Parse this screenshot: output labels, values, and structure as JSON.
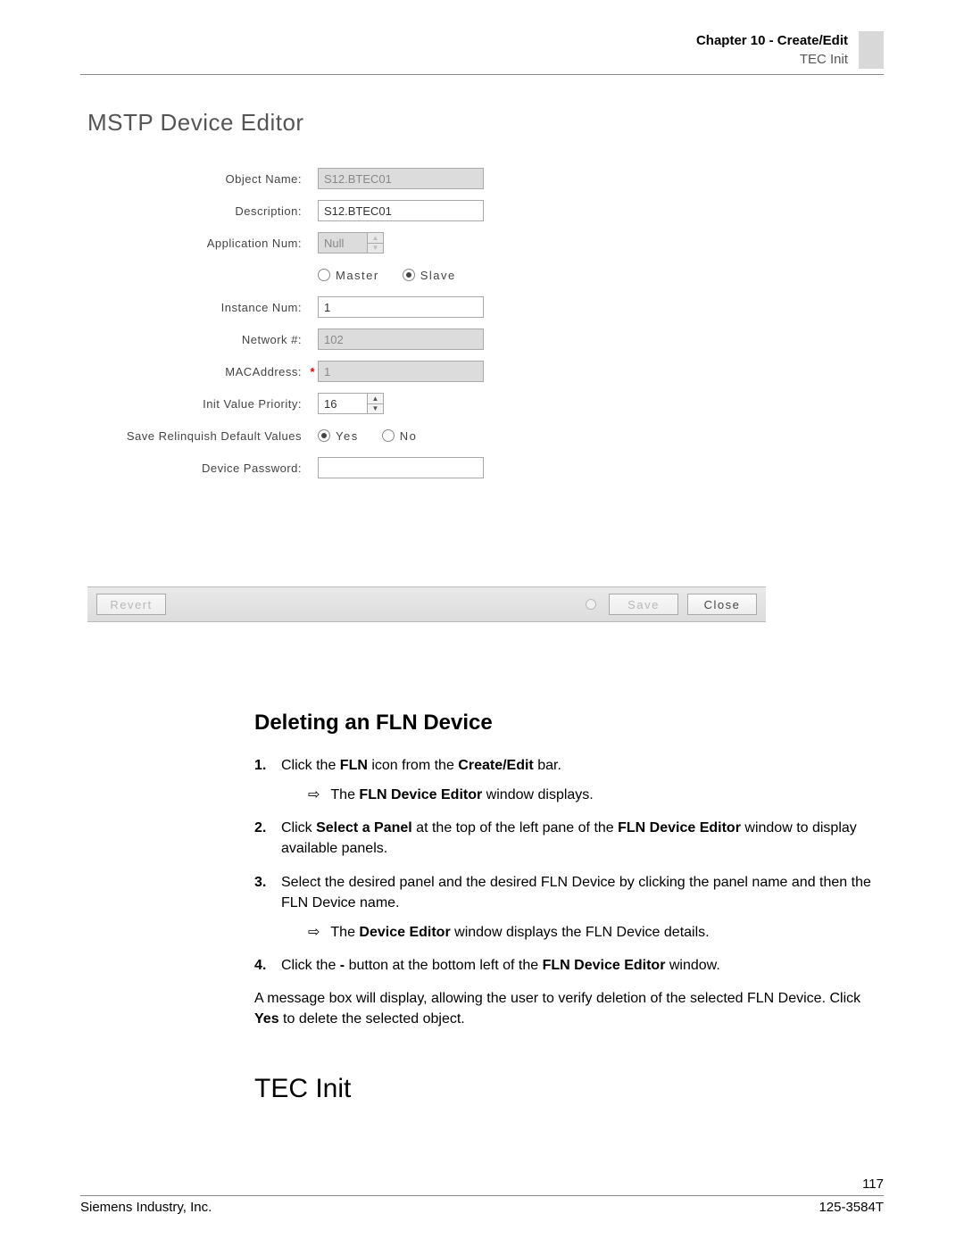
{
  "header": {
    "chapter": "Chapter 10 - Create/Edit",
    "section": "TEC Init"
  },
  "editor": {
    "title": "MSTP Device Editor",
    "labels": {
      "object_name": "Object Name:",
      "description": "Description:",
      "app_num": "Application Num:",
      "instance_num": "Instance Num:",
      "network": "Network #:",
      "mac": "MACAddress:",
      "init_priority": "Init Value Priority:",
      "save_relinquish": "Save Relinquish Default Values",
      "device_password": "Device Password:"
    },
    "values": {
      "object_name": "S12.BTEC01",
      "description": "S12.BTEC01",
      "app_num": "Null",
      "instance_num": "1",
      "network": "102",
      "mac": "1",
      "init_priority": "16",
      "device_password": ""
    },
    "radios": {
      "master": "Master",
      "slave": "Slave",
      "yes": "Yes",
      "no": "No"
    },
    "buttons": {
      "revert": "Revert",
      "save": "Save",
      "close": "Close"
    }
  },
  "body": {
    "h2": "Deleting an FLN Device",
    "step1_a": "Click the ",
    "step1_b": "FLN",
    "step1_c": " icon from the ",
    "step1_d": "Create/Edit",
    "step1_e": " bar.",
    "step1_sub_a": "The ",
    "step1_sub_b": "FLN Device Editor",
    "step1_sub_c": " window displays.",
    "step2_a": "Click ",
    "step2_b": "Select a Panel",
    "step2_c": " at the top of the left pane of the ",
    "step2_d": "FLN Device Editor",
    "step2_e": " window to display available panels.",
    "step3": "Select the desired panel and the desired FLN Device by clicking the panel name and then the FLN Device name.",
    "step3_sub_a": "The ",
    "step3_sub_b": "Device Editor",
    "step3_sub_c": " window displays the FLN Device details.",
    "step4_a": "Click the ",
    "step4_b": "-",
    "step4_c": " button at the bottom left of the ",
    "step4_d": "FLN Device Editor",
    "step4_e": " window.",
    "para_a": "A message box will display, allowing the user to verify deletion of the selected FLN Device. Click ",
    "para_b": "Yes",
    "para_c": " to delete the selected object.",
    "h1": "TEC Init"
  },
  "footer": {
    "page": "117",
    "left": "Siemens Industry, Inc.",
    "right": "125-3584T"
  }
}
